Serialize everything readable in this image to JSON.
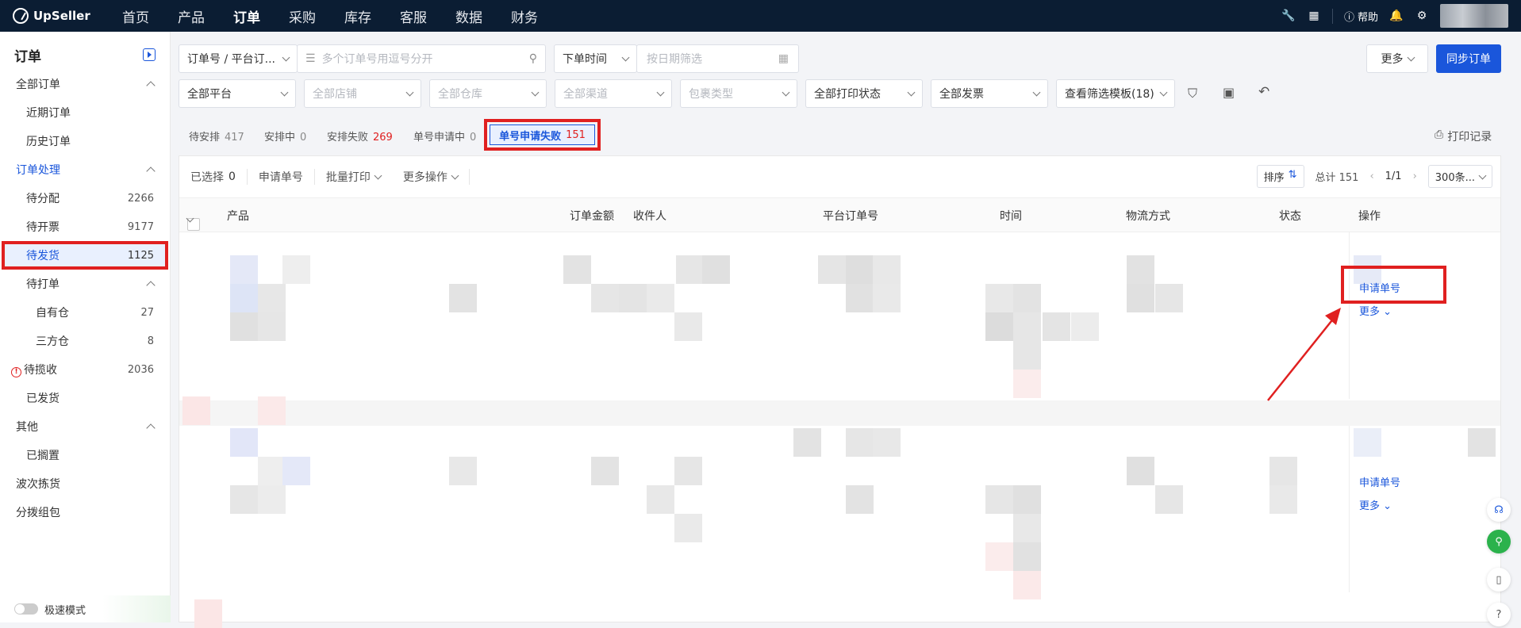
{
  "app": {
    "logo": "UpSeller"
  },
  "nav": [
    "首页",
    "产品",
    "订单",
    "采购",
    "库存",
    "客服",
    "数据",
    "财务"
  ],
  "nav_active": "订单",
  "topbar": {
    "help_label": "帮助"
  },
  "sidebar": {
    "title": "订单",
    "all_orders": "全部订单",
    "recent": "近期订单",
    "history": "历史订单",
    "processing": "订单处理",
    "to_assign": {
      "label": "待分配",
      "count": "2266"
    },
    "to_invoice": {
      "label": "待开票",
      "count": "9177"
    },
    "to_ship": {
      "label": "待发货",
      "count": "1125"
    },
    "to_print": "待打单",
    "own_wh": {
      "label": "自有仓",
      "count": "27"
    },
    "third_wh": {
      "label": "三方仓",
      "count": "8"
    },
    "to_collect": {
      "label": "待揽收",
      "count": "2036"
    },
    "shipped": "已发货",
    "other": "其他",
    "shelved": "已搁置",
    "wave_pick": "波次拣货",
    "sort_pack": "分拨组包",
    "speed_mode": "极速模式"
  },
  "filters": {
    "order_type": "订单号 / 平台订...",
    "search_placeholder": "多个订单号用逗号分开",
    "time_type": "下单时间",
    "date_placeholder": "按日期筛选",
    "platform": "全部平台",
    "store": "全部店铺",
    "warehouse": "全部仓库",
    "channel": "全部渠道",
    "package": "包裹类型",
    "print_status": "全部打印状态",
    "invoice": "全部发票",
    "template": "查看筛选模板(18)",
    "more": "更多",
    "sync": "同步订单"
  },
  "tabs": [
    {
      "label": "待安排",
      "count": "417"
    },
    {
      "label": "安排中",
      "count": "0"
    },
    {
      "label": "安排失败",
      "count": "269"
    },
    {
      "label": "单号申请中",
      "count": "0"
    },
    {
      "label": "单号申请失败",
      "count": "151"
    }
  ],
  "print_log": "打印记录",
  "toolbar": {
    "selected_label": "已选择",
    "selected_count": "0",
    "apply": "申请单号",
    "batch_print": "批量打印",
    "more_ops": "更多操作",
    "sort": "排序",
    "total": "总计 151",
    "page": "1/1",
    "page_size": "300条..."
  },
  "columns": {
    "product": "产品",
    "amount": "订单金额",
    "recipient": "收件人",
    "platform_order": "平台订单号",
    "time": "时间",
    "logistics": "物流方式",
    "status": "状态",
    "ops": "操作"
  },
  "rows": [
    {
      "apply": "申请单号",
      "more": "更多"
    },
    {
      "apply": "申请单号",
      "more": "更多"
    }
  ],
  "colors": {
    "brand": "#1a56db",
    "nav_bg": "#0b1d33",
    "highlight": "#e02020"
  }
}
